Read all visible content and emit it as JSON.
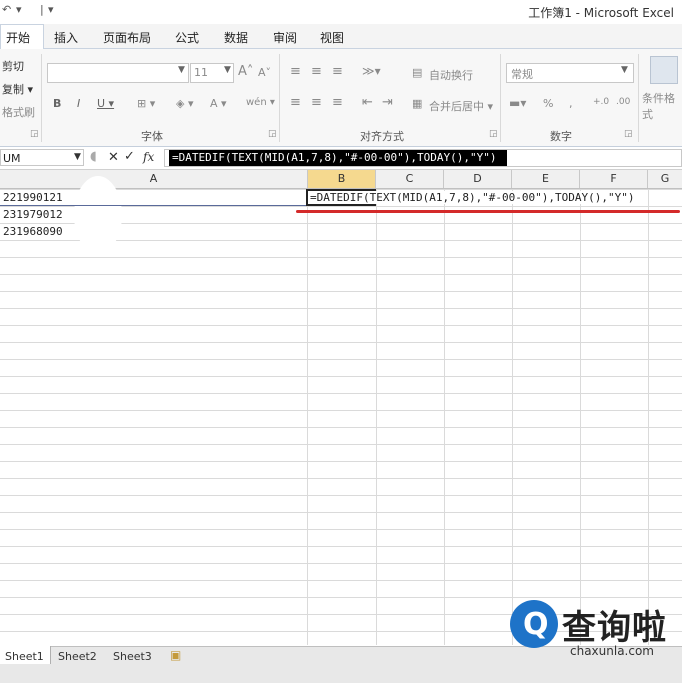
{
  "window": {
    "title": "工作簿1 - Microsoft Excel",
    "quick_access": [
      "↶",
      "▾",
      "|",
      "▾"
    ]
  },
  "tabs": [
    "开始",
    "插入",
    "页面布局",
    "公式",
    "数据",
    "审阅",
    "视图"
  ],
  "ribbon": {
    "clipboard": {
      "cut": "剪切",
      "copy": "复制 ▾",
      "format_painter": "格式刷"
    },
    "font": {
      "size": "11",
      "grow": "A˄",
      "shrink": "A˅",
      "bold": "B",
      "italic": "I",
      "underline": "U ▾",
      "border": "⊞ ▾",
      "fill": "◈ ▾",
      "font_color": "A ▾",
      "phonetic": "wén ▾",
      "label": "字体"
    },
    "alignment": {
      "wrap_text": "自动换行",
      "merge_center": "合并后居中 ▾",
      "label": "对齐方式"
    },
    "number": {
      "format": "常规",
      "percent": "%",
      "comma": ",",
      "inc_decimal": "+.0",
      "dec_decimal": ".00",
      "label": "数字"
    },
    "styles": {
      "conditional": "条件格式"
    }
  },
  "formula_bar": {
    "name_box": "UM",
    "cancel": "✕",
    "enter": "✓",
    "fx": "fx",
    "formula": "=DATEDIF(TEXT(MID(A1,7,8),\"#-00-00\"),TODAY(),\"Y\")"
  },
  "columns": [
    "A",
    "B",
    "C",
    "D",
    "E",
    "F",
    "G"
  ],
  "cells": {
    "A1": "221990121",
    "A2": "231979012",
    "A3": "231968090",
    "B1": "=DATEDIF(TEXT(MID(A1,7,8),\"#-00-00\"),TODAY(),\"Y\")"
  },
  "sheets": [
    "Sheet1",
    "Sheet2",
    "Sheet3"
  ],
  "watermark": {
    "name": "查询啦",
    "url": "chaxunla.com",
    "logo_letter": "Q"
  },
  "colors": {
    "accent_underline": "#d42a2a",
    "selected_column": "#f5d98f",
    "brand_blue": "#1e73c8"
  }
}
